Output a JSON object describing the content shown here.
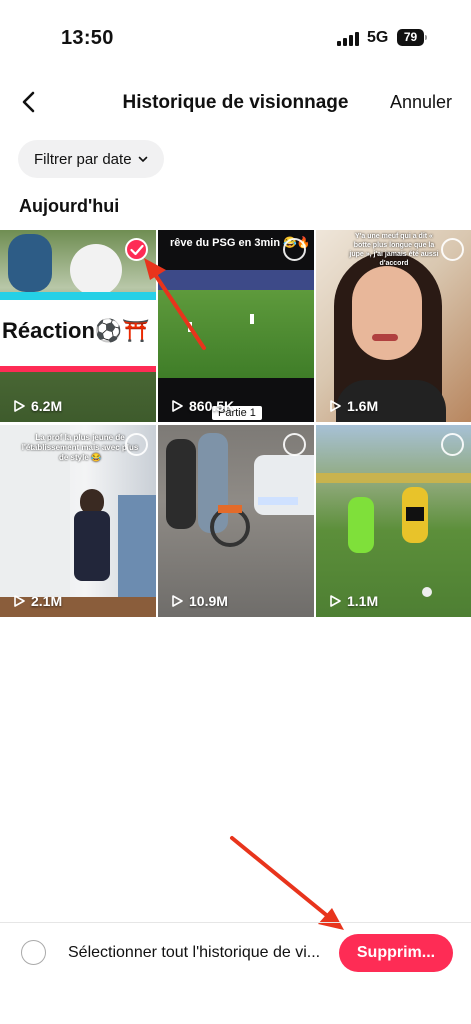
{
  "status_bar": {
    "time": "13:50",
    "network": "5G",
    "battery": "79"
  },
  "header": {
    "title": "Historique de visionnage",
    "cancel_label": "Annuler",
    "back_icon": "chevron-left-icon"
  },
  "filter": {
    "label": "Filtrer par date",
    "icon": "chevron-down-icon"
  },
  "section_title": "Aujourd'hui",
  "videos": [
    {
      "views": "6.2M",
      "selected": true,
      "caption": "Réaction⚽⛩️"
    },
    {
      "views": "860.5K",
      "selected": false,
      "caption": "rêve du PSG en 3min 😂🔥",
      "sub_caption": "Partie 1"
    },
    {
      "views": "1.6M",
      "selected": false,
      "caption": "Y'a une meuf qui a dit « botte plus longue que la jupe », j'ai jamais été aussi d'accord"
    },
    {
      "views": "2.1M",
      "selected": false,
      "caption": "La prof la plus jeune de l'établissement mais avec plus de style 😂"
    },
    {
      "views": "10.9M",
      "selected": false
    },
    {
      "views": "1.1M",
      "selected": false
    }
  ],
  "bottom_bar": {
    "select_all_label": "Sélectionner tout l'historique de vi...",
    "delete_label": "Supprim..."
  },
  "colors": {
    "accent": "#fe2c55",
    "annotation_arrow": "#e8341c"
  }
}
